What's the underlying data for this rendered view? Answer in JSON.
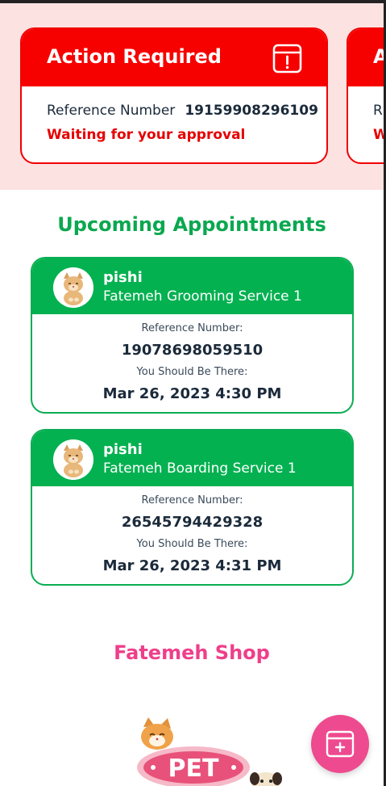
{
  "action_cards": [
    {
      "title": "Action Required",
      "reference_label": "Reference Number",
      "reference_number": "19159908296109",
      "status": "Waiting for your approval"
    },
    {
      "title": "A",
      "reference_label": "R",
      "reference_number": "",
      "status": "W"
    }
  ],
  "upcoming": {
    "title": "Upcoming Appointments",
    "appointments": [
      {
        "pet_name": "pishi",
        "service": "Fatemeh Grooming Service 1",
        "reference_label": "Reference Number:",
        "reference_number": "19078698059510",
        "time_label": "You Should Be There:",
        "time": "Mar 26, 2023 4:30 PM"
      },
      {
        "pet_name": "pishi",
        "service": "Fatemeh Boarding Service 1",
        "reference_label": "Reference Number:",
        "reference_number": "26545794429328",
        "time_label": "You Should Be There:",
        "time": "Mar 26, 2023 4:31 PM"
      }
    ]
  },
  "shop": {
    "title": "Fatemeh Shop",
    "logo_text": "PET"
  },
  "colors": {
    "alert_red": "#f70000",
    "alert_bg": "#fde2e2",
    "appointment_green": "#03b150",
    "shop_pink": "#ee3f8a"
  },
  "icons": {
    "action_card": "calendar-alert-icon",
    "avatar": "cat-avatar",
    "fab": "calendar-add-icon"
  }
}
